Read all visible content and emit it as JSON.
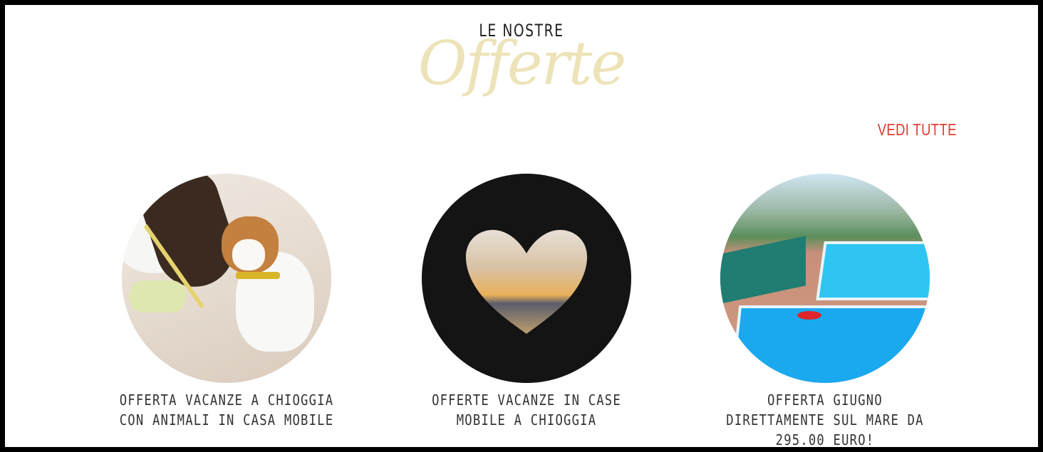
{
  "header": {
    "kicker": "LE NOSTRE",
    "title": "Offerte",
    "see_all": "VEDI TUTTE"
  },
  "colors": {
    "title": "#ede3b8",
    "see_all": "#e03a2d",
    "text": "#333333"
  },
  "offers": [
    {
      "caption": "OFFERTA VACANZE A CHIOGGIA CON ANIMALI IN CASA MOBILE",
      "image": "dog-on-beach"
    },
    {
      "caption": "OFFERTE VACANZE IN CASE MOBILE A CHIOGGIA",
      "image": "heart-hands-sunset"
    },
    {
      "caption": "OFFERTA GIUGNO DIRETTAMENTE SUL MARE DA 295.00 EURO!",
      "image": "camping-pool-aerial"
    }
  ]
}
